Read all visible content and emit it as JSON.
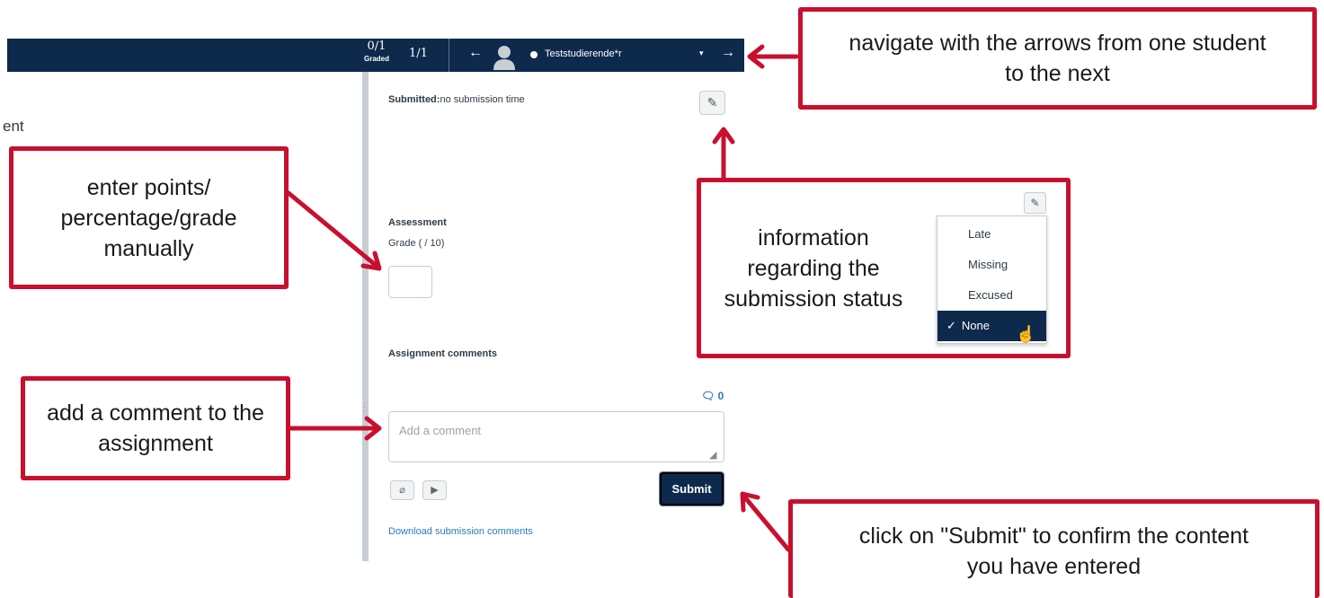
{
  "toolbar": {
    "graded_fraction": "0/1",
    "graded_label": "Graded",
    "student_count": "1/1",
    "prev_arrow": "←",
    "next_arrow": "→",
    "student_name": "Teststudierende*r",
    "caret": "▾",
    "bg_color": "#0d2a4d"
  },
  "left": {
    "partial_title": "ent"
  },
  "panel": {
    "submitted_label": "Submitted:",
    "submitted_value": "no submission time",
    "assessment_heading": "Assessment",
    "grade_label": "Grade ( / 10)",
    "grade_value": "",
    "comments_heading": "Assignment comments",
    "comment_count": "0",
    "comment_placeholder": "Add a comment",
    "submit_label": "Submit",
    "download_link": "Download submission comments"
  },
  "status_dropdown": {
    "options": [
      "Late",
      "Missing",
      "Excused",
      "None"
    ],
    "selected": "None",
    "check": "✓"
  },
  "callouts": {
    "navigate": "navigate with the arrows from one student to the next",
    "points": "enter points/ percentage/grade manually",
    "status": "information regarding the submission status",
    "comment": "add a comment to the assignment",
    "submit": "click on \"Submit\" to confirm the content you have entered",
    "border_color": "#c8102e"
  }
}
